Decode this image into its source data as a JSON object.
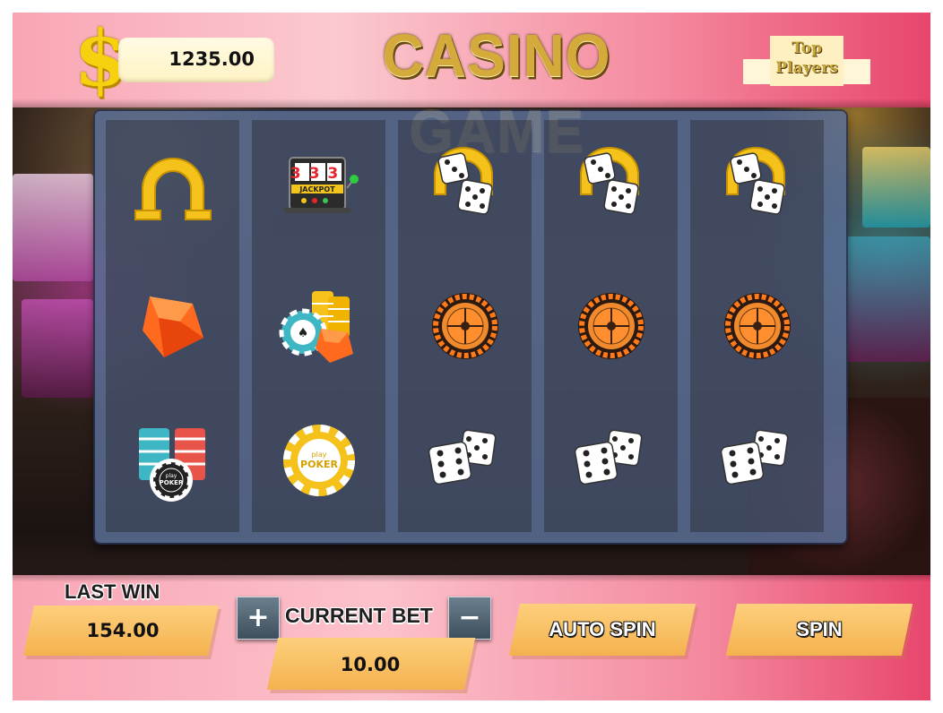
{
  "header": {
    "currency_symbol": "$",
    "balance": "1235.00",
    "title": "CASINO GAME",
    "top_players_line1": "Top",
    "top_players_line2": "Players"
  },
  "reels": [
    [
      "horseshoe-icon",
      "diamond-icon",
      "poker-chip-stack-icon"
    ],
    [
      "jackpot-machine-icon",
      "chips-and-diamond-icon",
      "poker-chip-icon"
    ],
    [
      "horseshoe-dice-icon",
      "roulette-wheel-icon",
      "dice-icon"
    ],
    [
      "horseshoe-dice-icon",
      "roulette-wheel-icon",
      "dice-icon"
    ],
    [
      "horseshoe-dice-icon",
      "roulette-wheel-icon",
      "dice-icon"
    ]
  ],
  "symbol_text": {
    "jackpot_digits": "333",
    "jackpot_word": "JACKPOT",
    "chip_small": "play",
    "chip_word": "POKER"
  },
  "footer": {
    "last_win_label": "LAST WIN",
    "last_win_value": "154.00",
    "plus": "+",
    "current_bet_label": "CURRENT BET",
    "minus": "−",
    "current_bet_value": "10.00",
    "auto_spin_label": "AUTO SPIN",
    "spin_label": "SPIN"
  },
  "colors": {
    "banner_pink": "#f9a5b4",
    "banner_red": "#e8466c",
    "gold": "#d4aa3b",
    "plate_orange": "#f4b24f",
    "reel_frame": "#5a6e96"
  }
}
